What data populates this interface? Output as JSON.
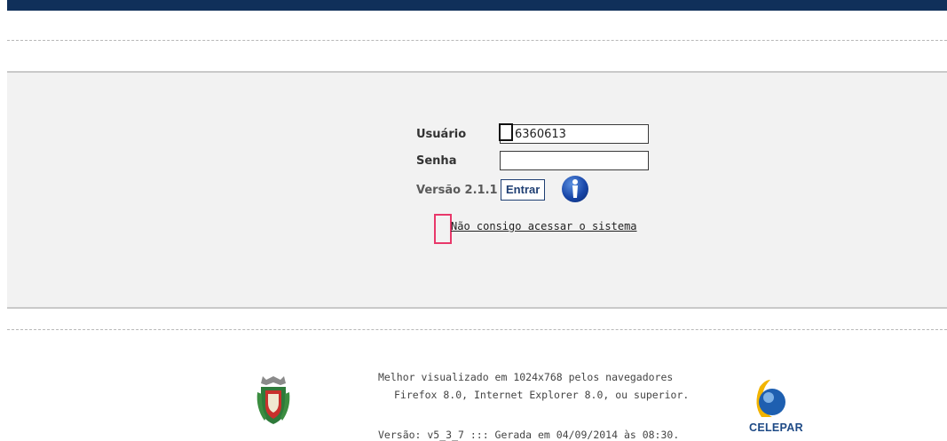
{
  "login": {
    "user_label": "Usuário",
    "user_value": "6360613",
    "password_label": "Senha",
    "password_value": "",
    "version_label": "Versão 2.1.1",
    "submit_label": "Entrar",
    "help_link": "Não consigo acessar o sistema"
  },
  "footer": {
    "line1": "Melhor visualizado em 1024x768 pelos navegadores",
    "line2": "Firefox 8.0, Internet Explorer 8.0, ou superior.",
    "line3": "Versão: v5_3_7 ::: Gerada em 04/09/2014 às 08:30.",
    "brand": "CELEPAR"
  },
  "icons": {
    "info": "info-icon",
    "crest": "parana-coat-of-arms",
    "brand_logo": "celepar-logo"
  },
  "colors": {
    "topbar": "#10305a",
    "button_border": "#1f3f73",
    "brand": "#1e4a86",
    "highlight_black": "#111111",
    "highlight_pink": "#e8386a"
  }
}
